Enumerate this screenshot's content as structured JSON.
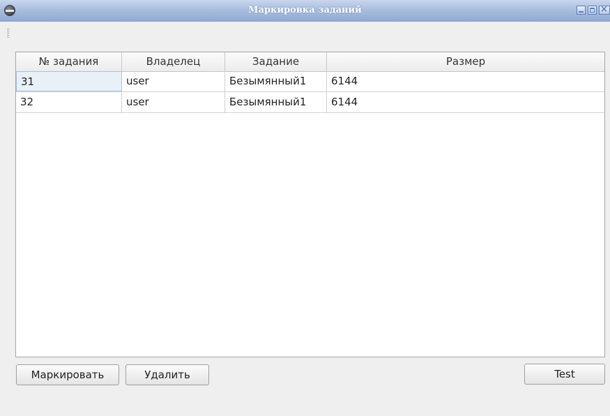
{
  "window": {
    "title": "Маркировка заданий"
  },
  "table": {
    "columns": [
      "№ задания",
      "Владелец",
      "Задание",
      "Размер"
    ],
    "rows": [
      [
        "31",
        "user",
        "Безымянный1",
        "6144"
      ],
      [
        "32",
        "user",
        "Безымянный1",
        "6144"
      ]
    ],
    "selected_cell": "31"
  },
  "buttons": {
    "mark_label": "Маркировать",
    "delete_label": "Удалить",
    "test_label": "Test"
  },
  "icons": {
    "app": "printer-icon",
    "minimize": "minimize-icon",
    "maximize": "maximize-icon",
    "close": "close-icon"
  },
  "colors": {
    "titlebar": "#a9bedf",
    "title_text": "#ffffff",
    "selection": "#e8f0f8"
  }
}
